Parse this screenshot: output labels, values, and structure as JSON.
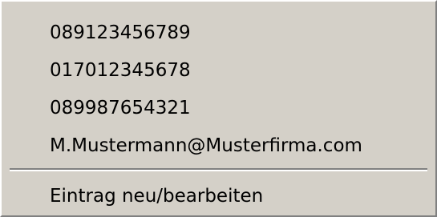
{
  "context_menu": {
    "items": [
      {
        "label": "089123456789"
      },
      {
        "label": "017012345678"
      },
      {
        "label": "089987654321"
      },
      {
        "label": "M.Mustermann@Musterfirma.com"
      }
    ],
    "edit_entry_label": "Eintrag neu/bearbeiten"
  }
}
